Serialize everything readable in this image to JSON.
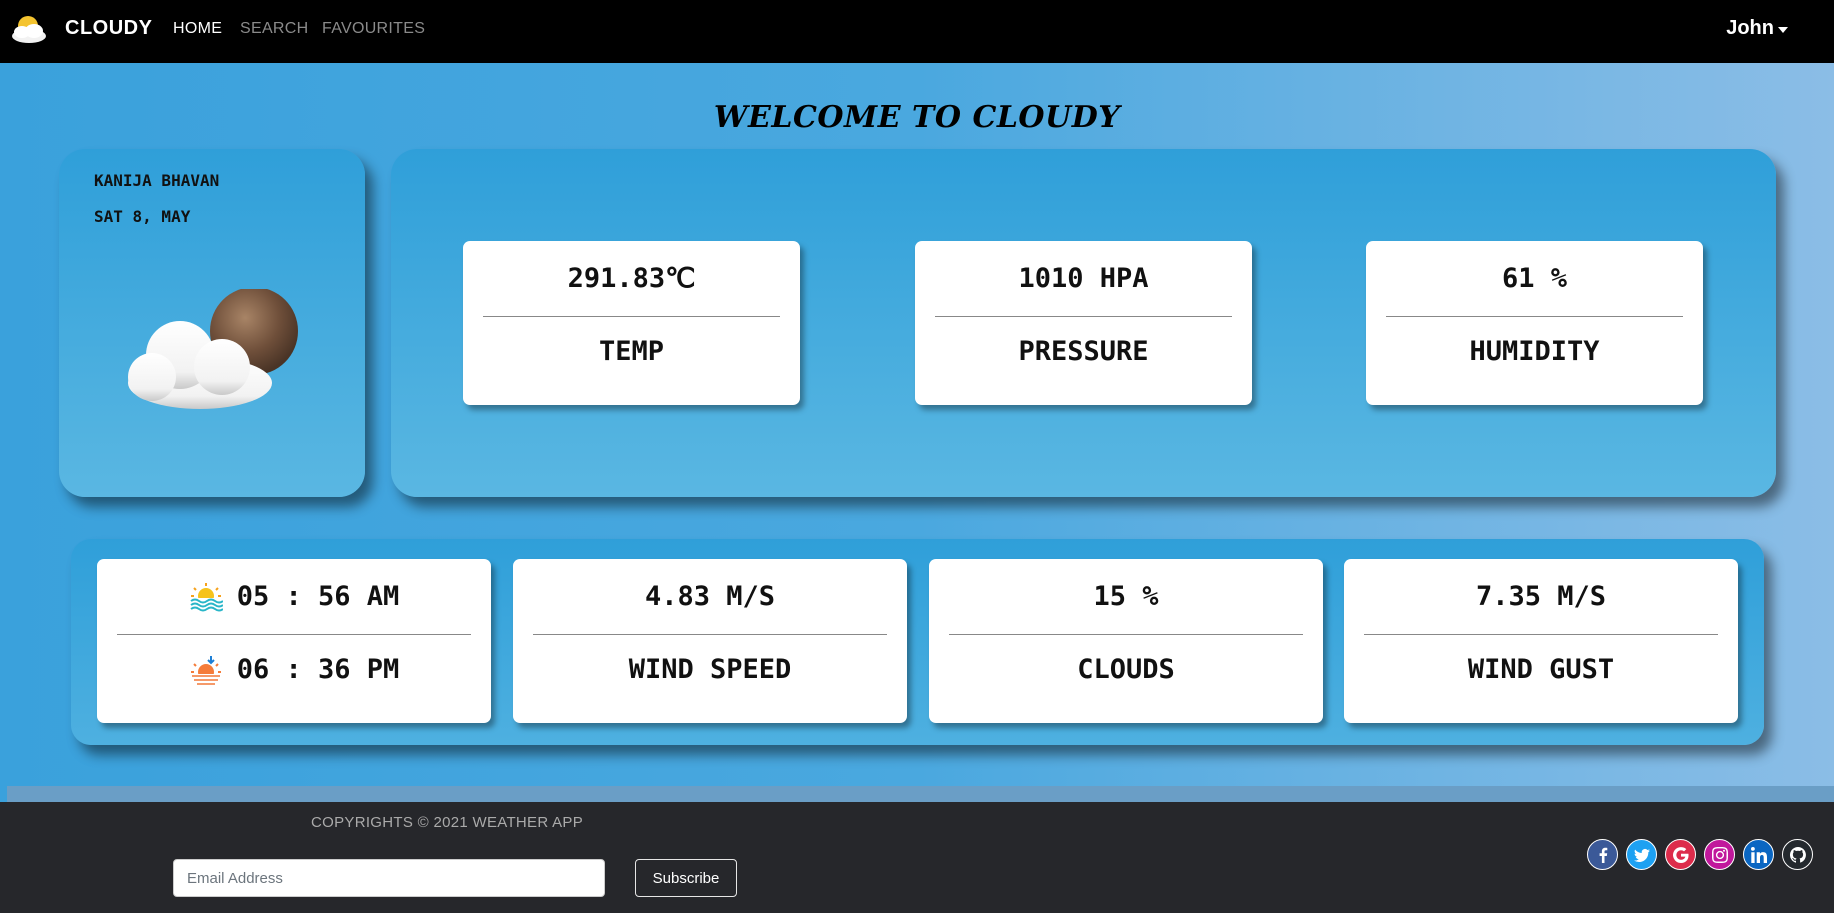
{
  "navbar": {
    "brand": "CLOUDY",
    "links": [
      "HOME",
      "SEARCH",
      "FAVOURITES"
    ],
    "active_link": "HOME",
    "user": "John"
  },
  "welcome": "WELCOME TO CLOUDY",
  "location": {
    "name": "KANIJA BHAVAN",
    "date": "SAT 8, MAY",
    "icon": "cloud-sun-icon"
  },
  "stats": [
    {
      "value": "291.83℃",
      "label": "TEMP"
    },
    {
      "value": "1010 HPA",
      "label": "PRESSURE"
    },
    {
      "value": "61 %",
      "label": "HUMIDITY"
    }
  ],
  "sun": {
    "sunrise": "05 : 56 AM",
    "sunset": "06 : 36 PM"
  },
  "details": [
    {
      "value": "4.83 M/S",
      "label": "WIND SPEED"
    },
    {
      "value": "15 %",
      "label": "CLOUDS"
    },
    {
      "value": "7.35 M/S",
      "label": "WIND GUST"
    }
  ],
  "footer": {
    "copyright": "COPYRIGHTS © 2021 WEATHER APP",
    "email_placeholder": "Email Address",
    "subscribe_label": "Subscribe",
    "socials": [
      {
        "name": "facebook-icon",
        "color": "#3b5998"
      },
      {
        "name": "twitter-icon",
        "color": "#1da1f2"
      },
      {
        "name": "google-icon",
        "color": "#dd2c4b"
      },
      {
        "name": "instagram-icon",
        "color": "#c1189c"
      },
      {
        "name": "linkedin-icon",
        "color": "#0a66c2"
      },
      {
        "name": "github-icon",
        "color": "#24292e"
      }
    ]
  }
}
